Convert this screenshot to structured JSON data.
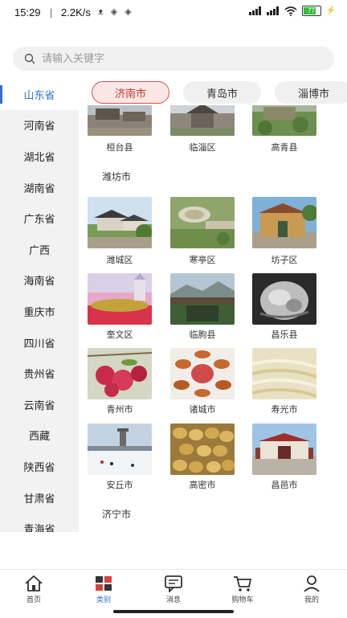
{
  "status_bar": {
    "time": "15:29",
    "separator": "|",
    "network_speed": "2.2K/s",
    "battery_level": "77",
    "small_icons": "ᴥ ◈ ◈"
  },
  "search": {
    "placeholder": "请输入关键字"
  },
  "sidebar": {
    "active_index": 0,
    "items": [
      "山东省",
      "河南省",
      "湖北省",
      "湖南省",
      "广东省",
      "广西",
      "海南省",
      "重庆市",
      "四川省",
      "贵州省",
      "云南省",
      "西藏",
      "陕西省",
      "甘肃省",
      "青海省"
    ]
  },
  "city_tabs": {
    "items": [
      "济南市",
      "青岛市",
      "淄博市"
    ],
    "active_index": 0
  },
  "content": {
    "top_row": [
      "桓台县",
      "临淄区",
      "高青县"
    ],
    "group1_title": "潍坊市",
    "cities": [
      "潍城区",
      "寒亭区",
      "坊子区",
      "奎文区",
      "临朐县",
      "昌乐县",
      "青州市",
      "诸城市",
      "寿光市",
      "安丘市",
      "高密市",
      "昌邑市"
    ],
    "group2_title": "济宁市"
  },
  "bottom_nav": {
    "items": [
      "首页",
      "类别",
      "消息",
      "购物车",
      "我的"
    ],
    "active_index": 1
  },
  "colors": {
    "accent": "#2e6fd6",
    "tab_active_border": "#d6504a",
    "sidebar_bg": "#f2f2f2"
  }
}
